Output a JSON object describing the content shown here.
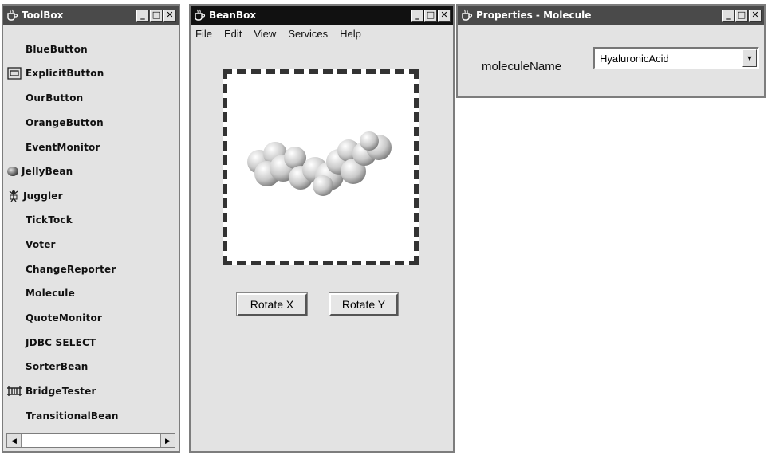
{
  "toolbox": {
    "title": "ToolBox",
    "items": [
      {
        "label": "BlueButton",
        "icon": ""
      },
      {
        "label": "ExplicitButton",
        "icon": "button-icon"
      },
      {
        "label": "OurButton",
        "icon": ""
      },
      {
        "label": "OrangeButton",
        "icon": ""
      },
      {
        "label": "EventMonitor",
        "icon": ""
      },
      {
        "label": "JellyBean",
        "icon": "jellybean-icon"
      },
      {
        "label": "Juggler",
        "icon": "juggler-icon"
      },
      {
        "label": "TickTock",
        "icon": ""
      },
      {
        "label": "Voter",
        "icon": ""
      },
      {
        "label": "ChangeReporter",
        "icon": ""
      },
      {
        "label": "Molecule",
        "icon": ""
      },
      {
        "label": "QuoteMonitor",
        "icon": ""
      },
      {
        "label": "JDBC SELECT",
        "icon": ""
      },
      {
        "label": "SorterBean",
        "icon": ""
      },
      {
        "label": "BridgeTester",
        "icon": "bridge-icon"
      },
      {
        "label": "TransitionalBean",
        "icon": ""
      }
    ]
  },
  "beanbox": {
    "title": "BeanBox",
    "menus": [
      "File",
      "Edit",
      "View",
      "Services",
      "Help"
    ],
    "rotate_x_label": "Rotate X",
    "rotate_y_label": "Rotate Y"
  },
  "properties": {
    "title": "Properties - Molecule",
    "field_label": "moleculeName",
    "field_value": "HyaluronicAcid"
  },
  "window_buttons": {
    "minimize": "_",
    "maximize": "□",
    "close": "✕"
  }
}
